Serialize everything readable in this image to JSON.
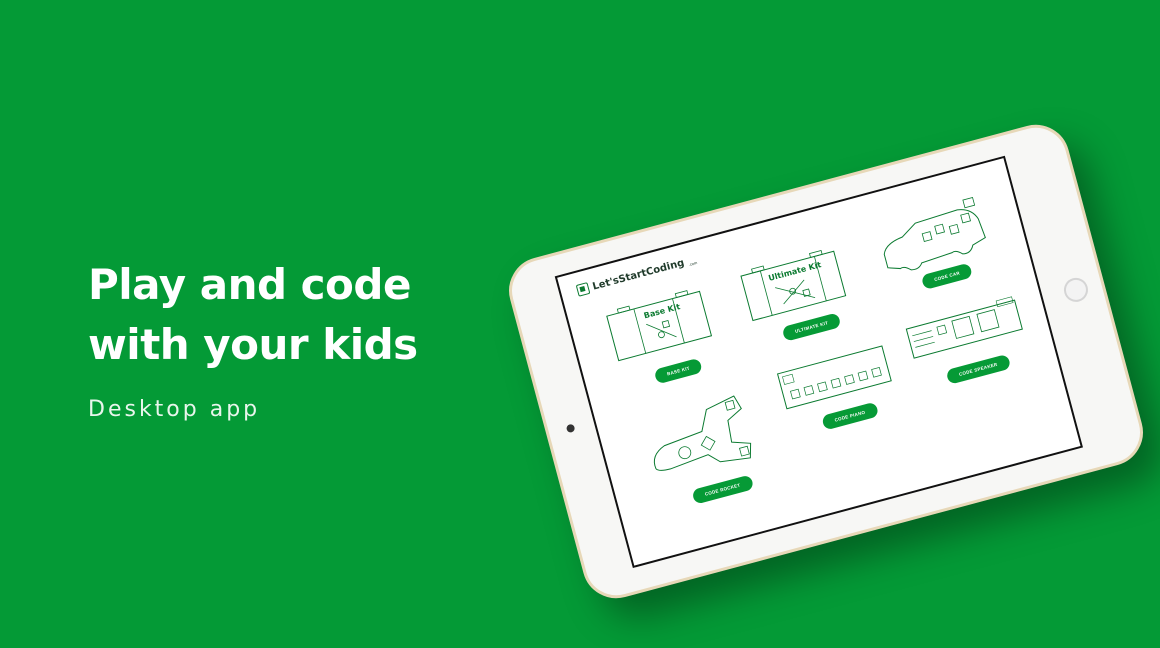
{
  "hero": {
    "title_line1": "Play and code",
    "title_line2": "with your kids",
    "subtitle": "Desktop app"
  },
  "tablet": {
    "brand_name": "Let'sStartCoding",
    "brand_suffix": ".com",
    "items": [
      {
        "label": "BASE KIT",
        "illustration_label": "Base Kit",
        "icon": "base-kit-icon"
      },
      {
        "label": "ULTIMATE KIT",
        "illustration_label": "Ultimate Kit",
        "icon": "ultimate-kit-icon"
      },
      {
        "label": "CODE CAR",
        "illustration_label": "",
        "icon": "code-car-icon"
      },
      {
        "label": "CODE ROCKET",
        "illustration_label": "",
        "icon": "code-rocket-icon"
      },
      {
        "label": "CODE PIANO",
        "illustration_label": "",
        "icon": "code-piano-icon"
      },
      {
        "label": "CODE SPEAKER",
        "illustration_label": "",
        "icon": "code-speaker-icon"
      }
    ]
  },
  "colors": {
    "background": "#049a36",
    "accent": "#069a36",
    "outline": "#0b7a30"
  }
}
